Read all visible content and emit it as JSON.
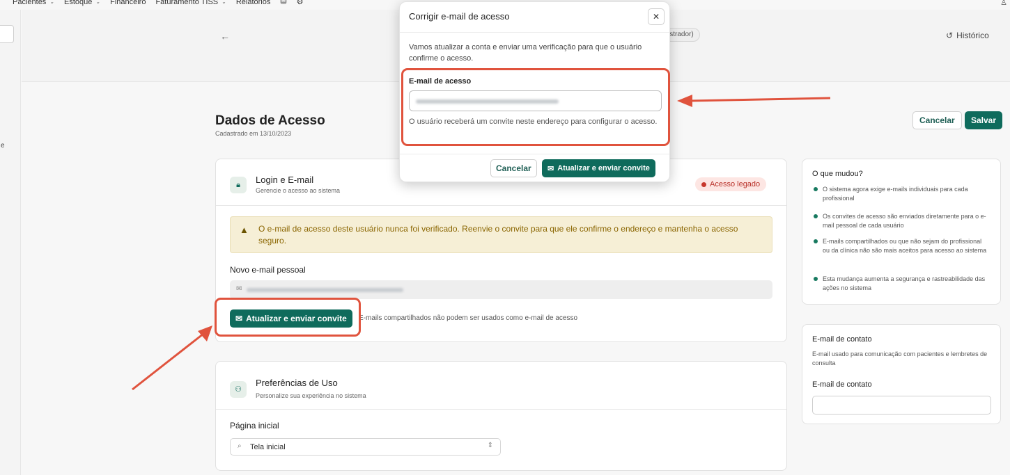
{
  "topnav": {
    "items": [
      {
        "label": "Pacientes",
        "has_menu": true
      },
      {
        "label": "Estoque",
        "has_menu": true
      },
      {
        "label": "Financeiro",
        "has_menu": false
      },
      {
        "label": "Faturamento TISS",
        "has_menu": true
      },
      {
        "label": "Relatórios",
        "has_menu": false
      }
    ],
    "icons": [
      "database-icon",
      "gear-icon"
    ]
  },
  "header": {
    "role_badge_fragment": "istrador)",
    "history_label": "Histórico"
  },
  "sidebar": {
    "text_fragment": "e"
  },
  "page": {
    "title": "Dados de Acesso",
    "subtitle": "Cadastrado em 13/10/2023",
    "cancel_label": "Cancelar",
    "save_label": "Salvar"
  },
  "login_card": {
    "title": "Login e E-mail",
    "subtitle": "Gerencie o acesso ao sistema",
    "badge": "Acesso legado",
    "warning": "O e-mail de acesso deste usuário nunca foi verificado. Reenvie o convite para que ele confirme o endereço e mantenha o acesso seguro.",
    "new_email_label": "Novo e-mail pessoal",
    "update_button": "Atualizar e enviar convite",
    "hint": "E-mails compartilhados não podem ser usados como e-mail de acesso"
  },
  "prefs_card": {
    "title": "Preferências de Uso",
    "subtitle": "Personalize sua experiência no sistema",
    "home_label": "Página inicial",
    "home_value": "Tela inicial"
  },
  "changes_card": {
    "title": "O que mudou?",
    "items": [
      "O sistema agora exige e-mails individuais para cada profissional",
      "Os convites de acesso são enviados diretamente para o e-mail pessoal de cada usuário",
      "E-mails compartilhados ou que não sejam do profissional ou da clínica não são mais aceitos para acesso ao sistema",
      "Esta mudança aumenta a segurança e rastreabilidade das ações no sistema"
    ]
  },
  "contact_card": {
    "title": "E-mail de contato",
    "description": "E-mail usado para comunicação com pacientes e lembretes de consulta",
    "field_label": "E-mail de contato"
  },
  "modal": {
    "title": "Corrigir e-mail de acesso",
    "close_glyph": "✕",
    "description": "Vamos atualizar a conta e enviar uma verificação para que o usuário confirme o acesso.",
    "field_label": "E-mail de acesso",
    "hint": "O usuário receberá um convite neste endereço para configurar o acesso.",
    "cancel_label": "Cancelar",
    "confirm_label": "Atualizar e enviar convite"
  },
  "colors": {
    "primary": "#0f6b5c",
    "warning_bg": "#f6efd6",
    "warning_text": "#8a6500",
    "danger": "#c7382d",
    "annotation": "#e0533d"
  }
}
